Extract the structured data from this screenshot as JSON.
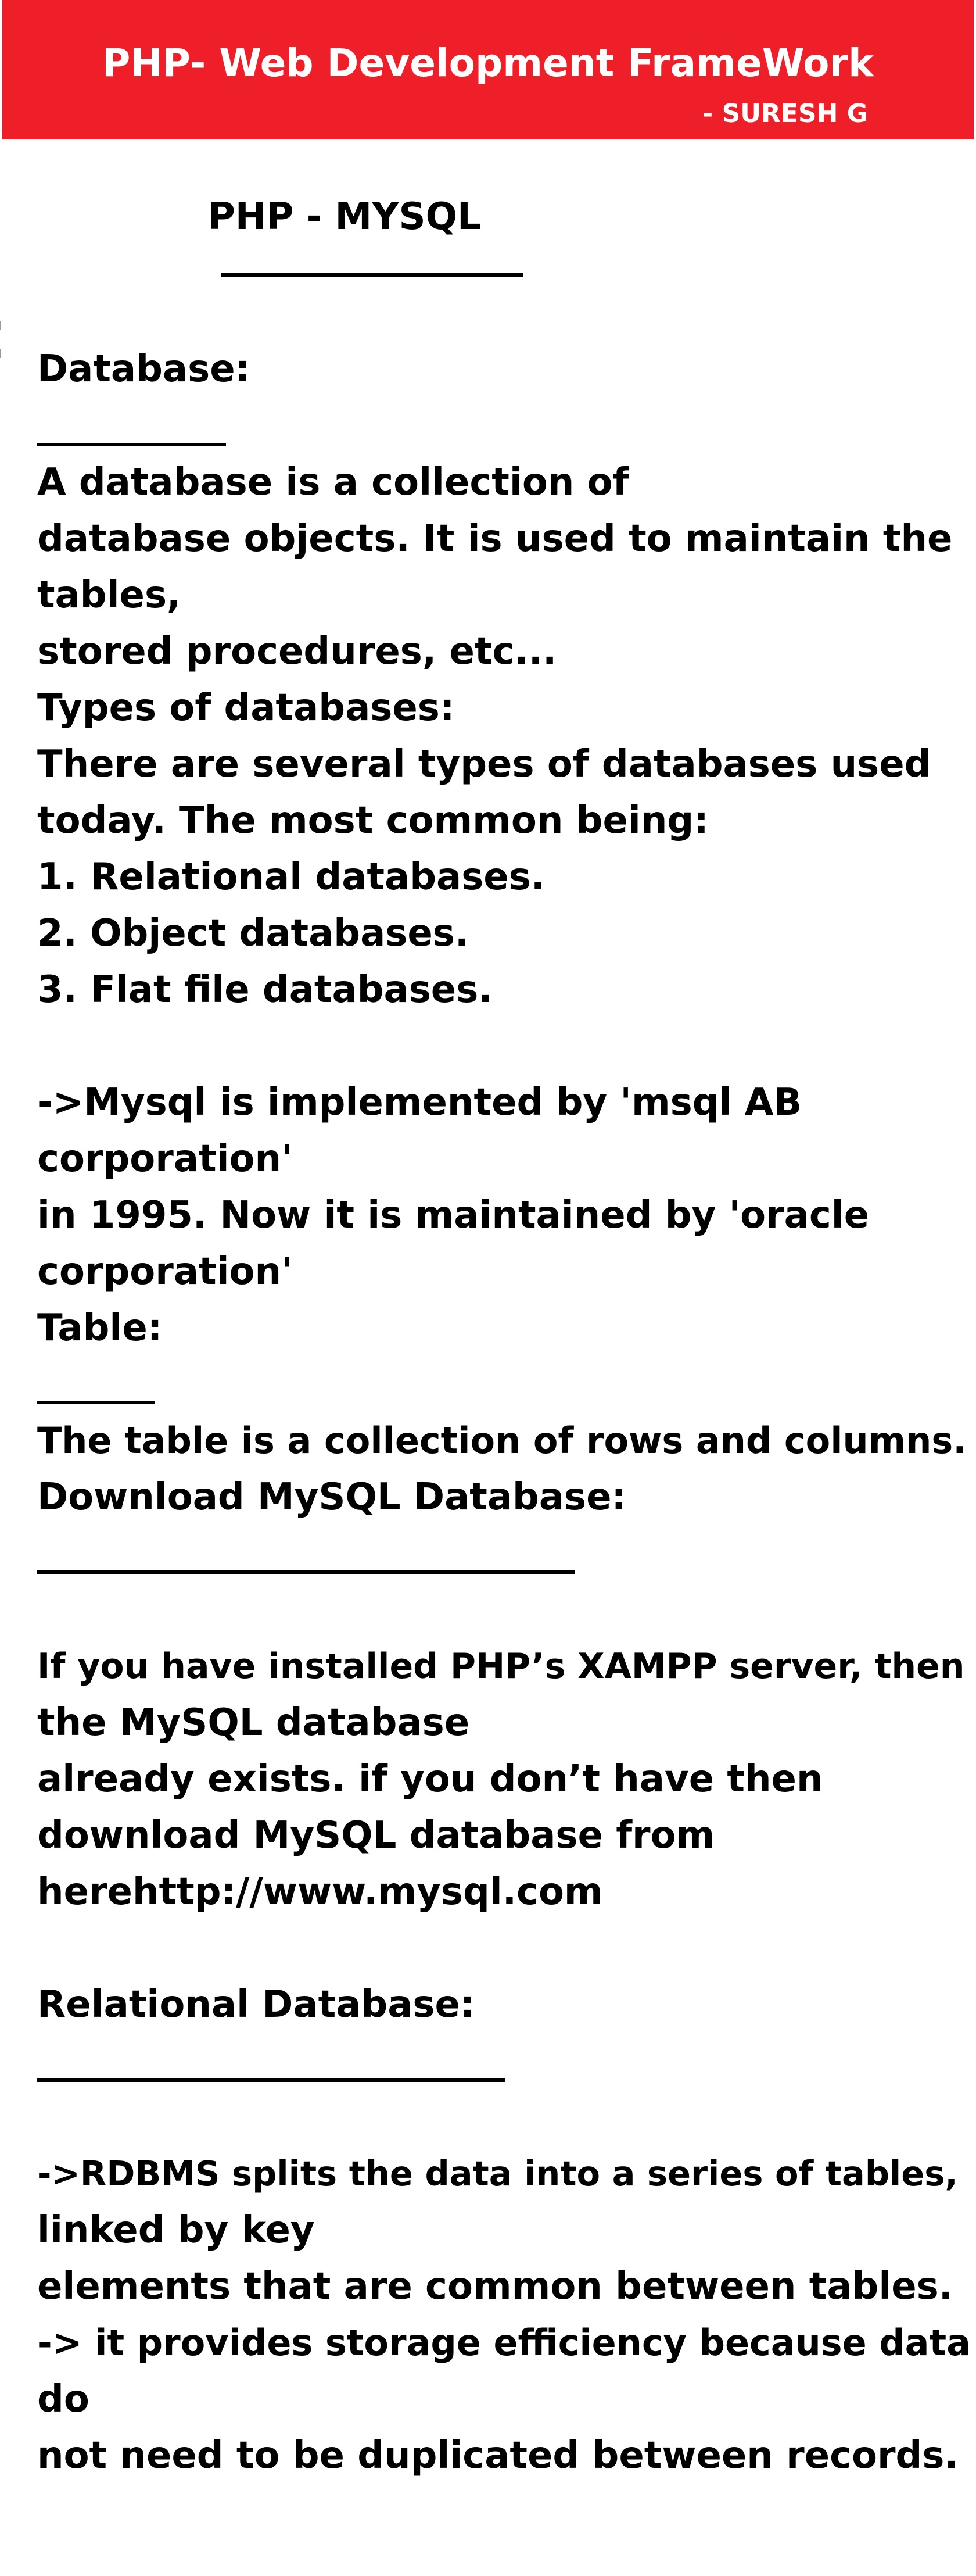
{
  "header": {
    "title": "PHP- Web Development FrameWork",
    "author": "- SURESH  G",
    "bg_color": "#ee1f28",
    "text_color": "#ffffff"
  },
  "document": {
    "heading": "PHP - MYSQL",
    "sections": {
      "database": {
        "label": "Database:",
        "lines": [
          "A database is a collection of",
          "database objects. It is used to maintain the",
          "tables,",
          "stored procedures, etc...",
          "Types of databases:",
          "There are several types of databases used",
          "today. The most common being:",
          "1. Relational databases.",
          "2. Object databases.",
          "3. Flat file databases."
        ]
      },
      "mysql": {
        "lines": [
          "->Mysql is implemented by 'msql AB",
          "corporation'",
          " in 1995. Now it is maintained by 'oracle",
          "corporation'"
        ]
      },
      "table": {
        "label": "Table:",
        "lines": [
          "The table is a collection of rows and columns."
        ]
      },
      "download": {
        "label": "Download MySQL Database:",
        "lines": [
          "If you have installed PHP’s  XAMPP server, then",
          "the MySQL database",
          "already exists. if you don’t have then",
          "download MySQL database from",
          "herehttp://www.mysql.com"
        ]
      },
      "relational": {
        "label": "Relational Database:",
        "lines": [
          "->RDBMS splits the data into a series of tables,",
          "linked by key",
          "elements that are common between tables.",
          "-> it provides storage efficiency because data",
          "do",
          "not need to be duplicated between records."
        ]
      }
    }
  }
}
